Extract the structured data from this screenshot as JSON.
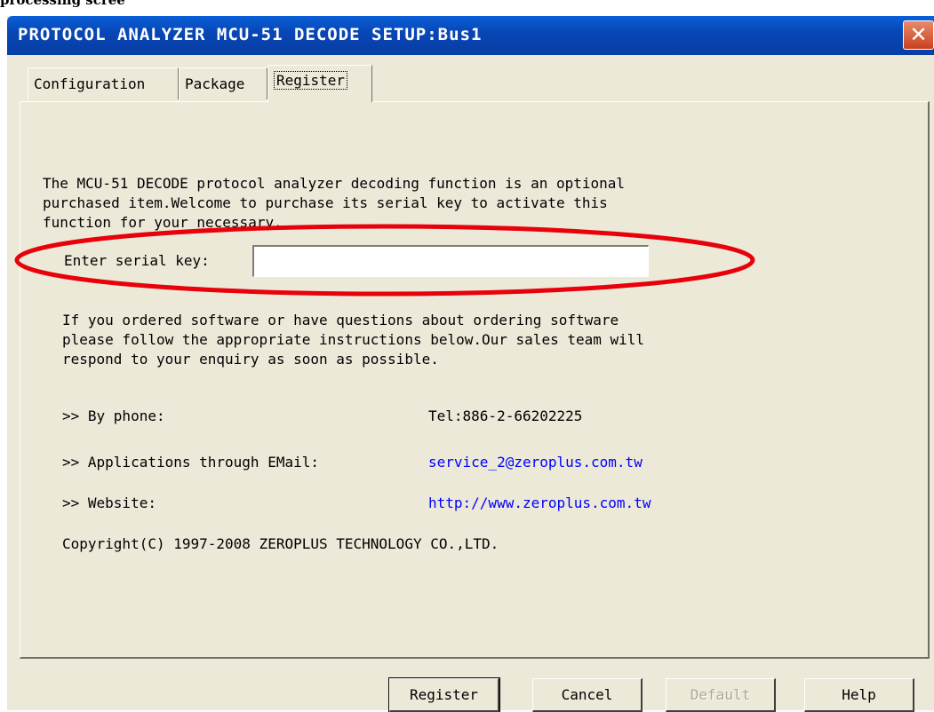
{
  "background_caption": "processing scree",
  "window": {
    "title": "PROTOCOL ANALYZER MCU-51 DECODE SETUP:Bus1",
    "close_glyph": "✕"
  },
  "tabs": [
    {
      "label": "Configuration",
      "active": false
    },
    {
      "label": "Package",
      "active": false
    },
    {
      "label": "Register",
      "active": true
    }
  ],
  "register": {
    "intro_lines": [
      "The MCU-51 DECODE protocol analyzer decoding function is an optional",
      "purchased item.Welcome to purchase its serial key to activate this",
      "function for your necessary."
    ],
    "serial_label": "Enter serial key:",
    "serial_value": "",
    "info_lines": [
      "If you ordered software or have questions about ordering software",
      "please follow the appropriate instructions below.Our sales team will",
      "respond to your enquiry as soon as possible."
    ],
    "contacts": [
      {
        "label": ">> By phone:",
        "value": "Tel:886-2-66202225",
        "is_link": false
      },
      {
        "label": ">> Applications through EMail:",
        "value": "service_2@zeroplus.com.tw",
        "is_link": true
      },
      {
        "label": ">> Website:",
        "value": "http://www.zeroplus.com.tw",
        "is_link": true
      }
    ],
    "copyright": "Copyright(C) 1997-2008 ZEROPLUS TECHNOLOGY CO.,LTD."
  },
  "buttons": {
    "register": "Register",
    "cancel": "Cancel",
    "default": "Default",
    "help": "Help"
  },
  "colors": {
    "titlebar": "#0847b6",
    "dialog_face": "#ece9d8",
    "link": "#0000ff",
    "annotation_oval": "#e8000a"
  }
}
